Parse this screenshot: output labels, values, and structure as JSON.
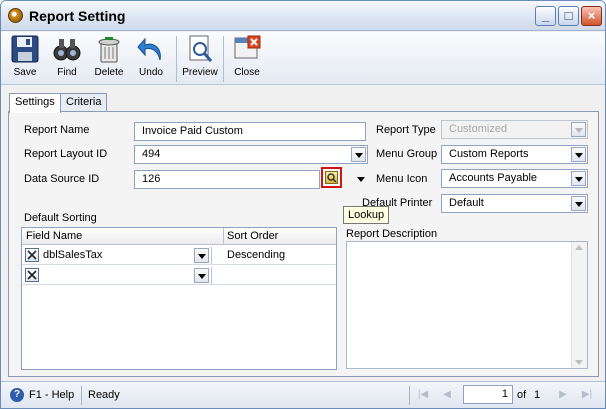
{
  "window": {
    "title": "Report Setting",
    "minimize": "_",
    "maximize": "□",
    "close": "×"
  },
  "toolbar": {
    "save": "Save",
    "find": "Find",
    "delete": "Delete",
    "undo": "Undo",
    "preview": "Preview",
    "close": "Close"
  },
  "tabs": [
    {
      "label": "Settings",
      "active": true
    },
    {
      "label": "Criteria",
      "active": false
    }
  ],
  "form": {
    "report_name_label": "Report Name",
    "report_name_value": "Invoice Paid Custom",
    "report_layout_label": "Report Layout ID",
    "report_layout_value": "494",
    "data_source_label": "Data Source ID",
    "data_source_value": "126",
    "report_type_label": "Report Type",
    "report_type_value": "Customized",
    "menu_group_label": "Menu Group",
    "menu_group_value": "Custom Reports",
    "menu_icon_label": "Menu Icon",
    "menu_icon_value": "Accounts Payable",
    "default_printer_label": "Default Printer",
    "default_printer_value": "Default",
    "report_description_label": "Report Description",
    "lookup_tooltip": "Lookup"
  },
  "sorting": {
    "label": "Default Sorting",
    "columns": [
      "Field Name",
      "Sort Order"
    ],
    "rows": [
      {
        "field": "dblSalesTax",
        "order": "Descending"
      },
      {
        "field": "",
        "order": ""
      }
    ]
  },
  "status": {
    "help": "F1 - Help",
    "state": "Ready",
    "page": "1",
    "of": "of",
    "total": "1"
  },
  "colors": {
    "accent": "#2f5cab",
    "lookup_border": "#d11515",
    "tooltip_bg": "#ffffe1"
  }
}
